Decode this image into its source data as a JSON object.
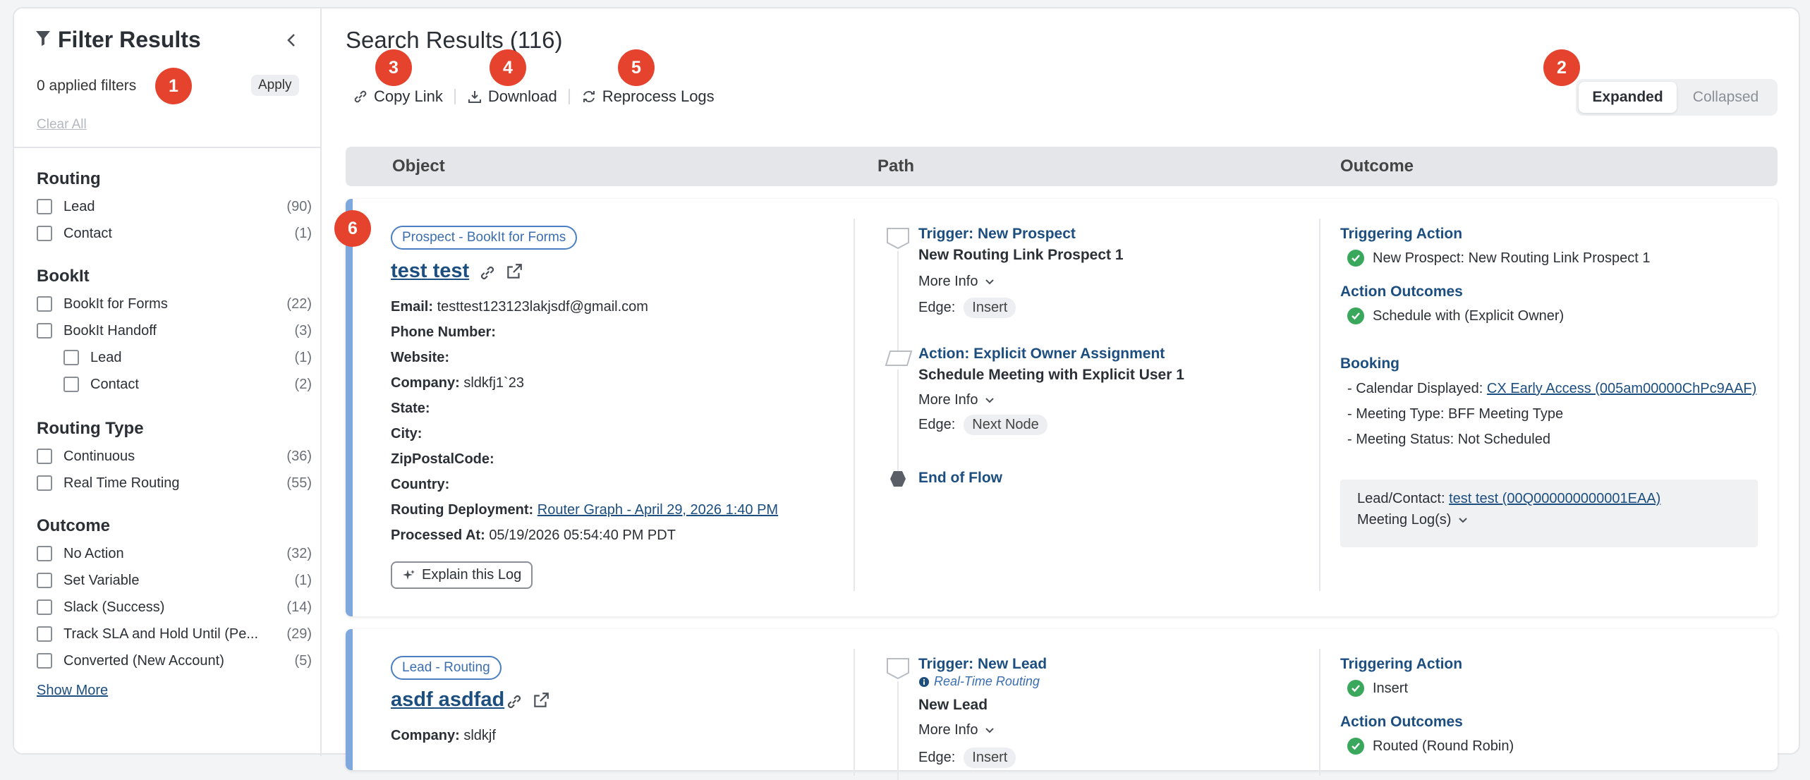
{
  "sidebar": {
    "title": "Filter Results",
    "applied_filters": "0 applied filters",
    "apply_label": "Apply",
    "clear_all": "Clear All",
    "groups": [
      {
        "title": "Routing",
        "options": [
          {
            "label": "Lead",
            "count": "(90)"
          },
          {
            "label": "Contact",
            "count": "(1)"
          }
        ]
      },
      {
        "title": "BookIt",
        "options": [
          {
            "label": "BookIt for Forms",
            "count": "(22)"
          },
          {
            "label": "BookIt Handoff",
            "count": "(3)"
          },
          {
            "label": "Lead",
            "count": "(1)"
          },
          {
            "label": "Contact",
            "count": "(2)"
          }
        ]
      },
      {
        "title": "Routing Type",
        "options": [
          {
            "label": "Continuous",
            "count": "(36)"
          },
          {
            "label": "Real Time Routing",
            "count": "(55)"
          }
        ]
      },
      {
        "title": "Outcome",
        "options": [
          {
            "label": "No Action",
            "count": "(32)"
          },
          {
            "label": "Set Variable",
            "count": "(1)"
          },
          {
            "label": "Slack (Success)",
            "count": "(14)"
          },
          {
            "label": "Track SLA and Hold Until (Pe...",
            "count": "(29)"
          },
          {
            "label": "Converted (New Account)",
            "count": "(5)"
          }
        ]
      }
    ],
    "show_more": "Show More"
  },
  "main": {
    "title": "Search Results (116)",
    "toolbar": {
      "copy_link": "Copy Link",
      "download": "Download",
      "reprocess": "Reprocess Logs"
    },
    "view_toggle": {
      "expanded": "Expanded",
      "collapsed": "Collapsed"
    },
    "columns": {
      "object": "Object",
      "path": "Path",
      "outcome": "Outcome"
    },
    "badges": [
      "1",
      "2",
      "3",
      "4",
      "5",
      "6"
    ]
  },
  "results": [
    {
      "pill": "Prospect - BookIt for Forms",
      "title": "test test",
      "fields": {
        "email_label": "Email:",
        "email": "testtest123123lakjsdf@gmail.com",
        "phone_label": "Phone Number:",
        "website_label": "Website:",
        "company_label": "Company:",
        "company": "sldkfj1`23",
        "state_label": "State:",
        "city_label": "City:",
        "zip_label": "ZipPostalCode:",
        "country_label": "Country:",
        "deployment_label": "Routing Deployment:",
        "deployment": "Router Graph - April 29, 2026 1:40 PM",
        "processed_label": "Processed At:",
        "processed": "05/19/2026 05:54:40 PM PDT"
      },
      "explain": "Explain this Log",
      "path": {
        "node1_link": "Trigger: New Prospect",
        "node1_title": "New Routing Link Prospect 1",
        "node1_more": "More Info",
        "node1_edge_label": "Edge:",
        "node1_edge": "Insert",
        "node2_link": "Action: Explicit Owner Assignment",
        "node2_title": "Schedule Meeting with Explicit User 1",
        "node2_more": "More Info",
        "node2_edge_label": "Edge:",
        "node2_edge": "Next Node",
        "end": "End of Flow"
      },
      "outcome": {
        "triggering_label": "Triggering Action",
        "triggering": "New Prospect: New Routing Link Prospect 1",
        "outcomes_label": "Action Outcomes",
        "outcome1": "Schedule with (Explicit Owner)",
        "booking_label": "Booking",
        "calendar_prefix": "- Calendar Displayed:",
        "calendar_link": "CX Early Access (005am00000ChPc9AAF)",
        "meeting_type": "- Meeting Type: BFF Meeting Type",
        "meeting_status": "- Meeting Status: Not Scheduled",
        "lead_contact_label": "Lead/Contact:",
        "lead_contact_link": "test test (00Q000000000001EAA)",
        "meeting_logs": "Meeting Log(s)"
      }
    },
    {
      "pill": "Lead - Routing",
      "title": "asdf asdfad",
      "fields": {
        "company_label": "Company:",
        "company": "sldkjf"
      },
      "path": {
        "node1_link": "Trigger: New Lead",
        "node1_sub": "Real-Time Routing",
        "node1_title": "New Lead",
        "node1_more": "More Info",
        "node1_edge_label": "Edge:",
        "node1_edge": "Insert"
      },
      "outcome": {
        "triggering_label": "Triggering Action",
        "triggering": "Insert",
        "outcomes_label": "Action Outcomes",
        "outcome1": "Routed (Round Robin)"
      }
    }
  ]
}
